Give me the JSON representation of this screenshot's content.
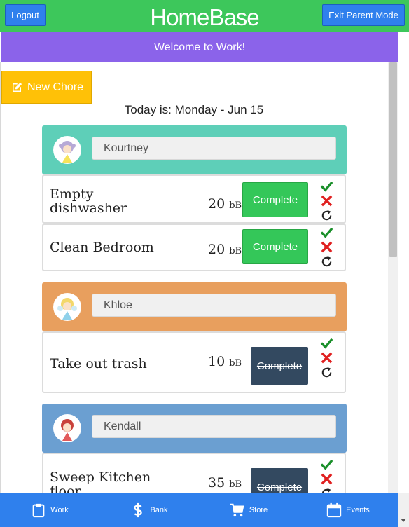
{
  "header": {
    "title": "HomeBase",
    "logout_label": "Logout",
    "exit_label": "Exit Parent Mode"
  },
  "banner": {
    "text": "Welcome to Work!"
  },
  "toolbar": {
    "new_chore_label": "New Chore"
  },
  "today": {
    "text": "Today is: Monday - Jun 15"
  },
  "people": [
    {
      "name": "Kourtney",
      "color": "#5ecfb8",
      "chores": [
        {
          "name": "Empty dishwasher",
          "points": "20",
          "unit": "bB",
          "button": "Complete",
          "done": false
        },
        {
          "name": "Clean Bedroom",
          "points": "20",
          "unit": "bB",
          "button": "Complete",
          "done": false
        }
      ]
    },
    {
      "name": "Khloe",
      "color": "#e89f5e",
      "chores": [
        {
          "name": "Take out trash",
          "points": "10",
          "unit": "bB",
          "button": "Complete",
          "done": true
        }
      ]
    },
    {
      "name": "Kendall",
      "color": "#6b9fd1",
      "chores": [
        {
          "name": "Sweep Kitchen floor",
          "points": "35",
          "unit": "bB",
          "button": "Complete",
          "done": true
        }
      ]
    }
  ],
  "footer": {
    "tabs": [
      {
        "label": "Work",
        "icon": "clipboard-icon"
      },
      {
        "label": "Bank",
        "icon": "dollar-icon"
      },
      {
        "label": "Store",
        "icon": "cart-icon"
      },
      {
        "label": "Events",
        "icon": "calendar-icon"
      }
    ]
  }
}
